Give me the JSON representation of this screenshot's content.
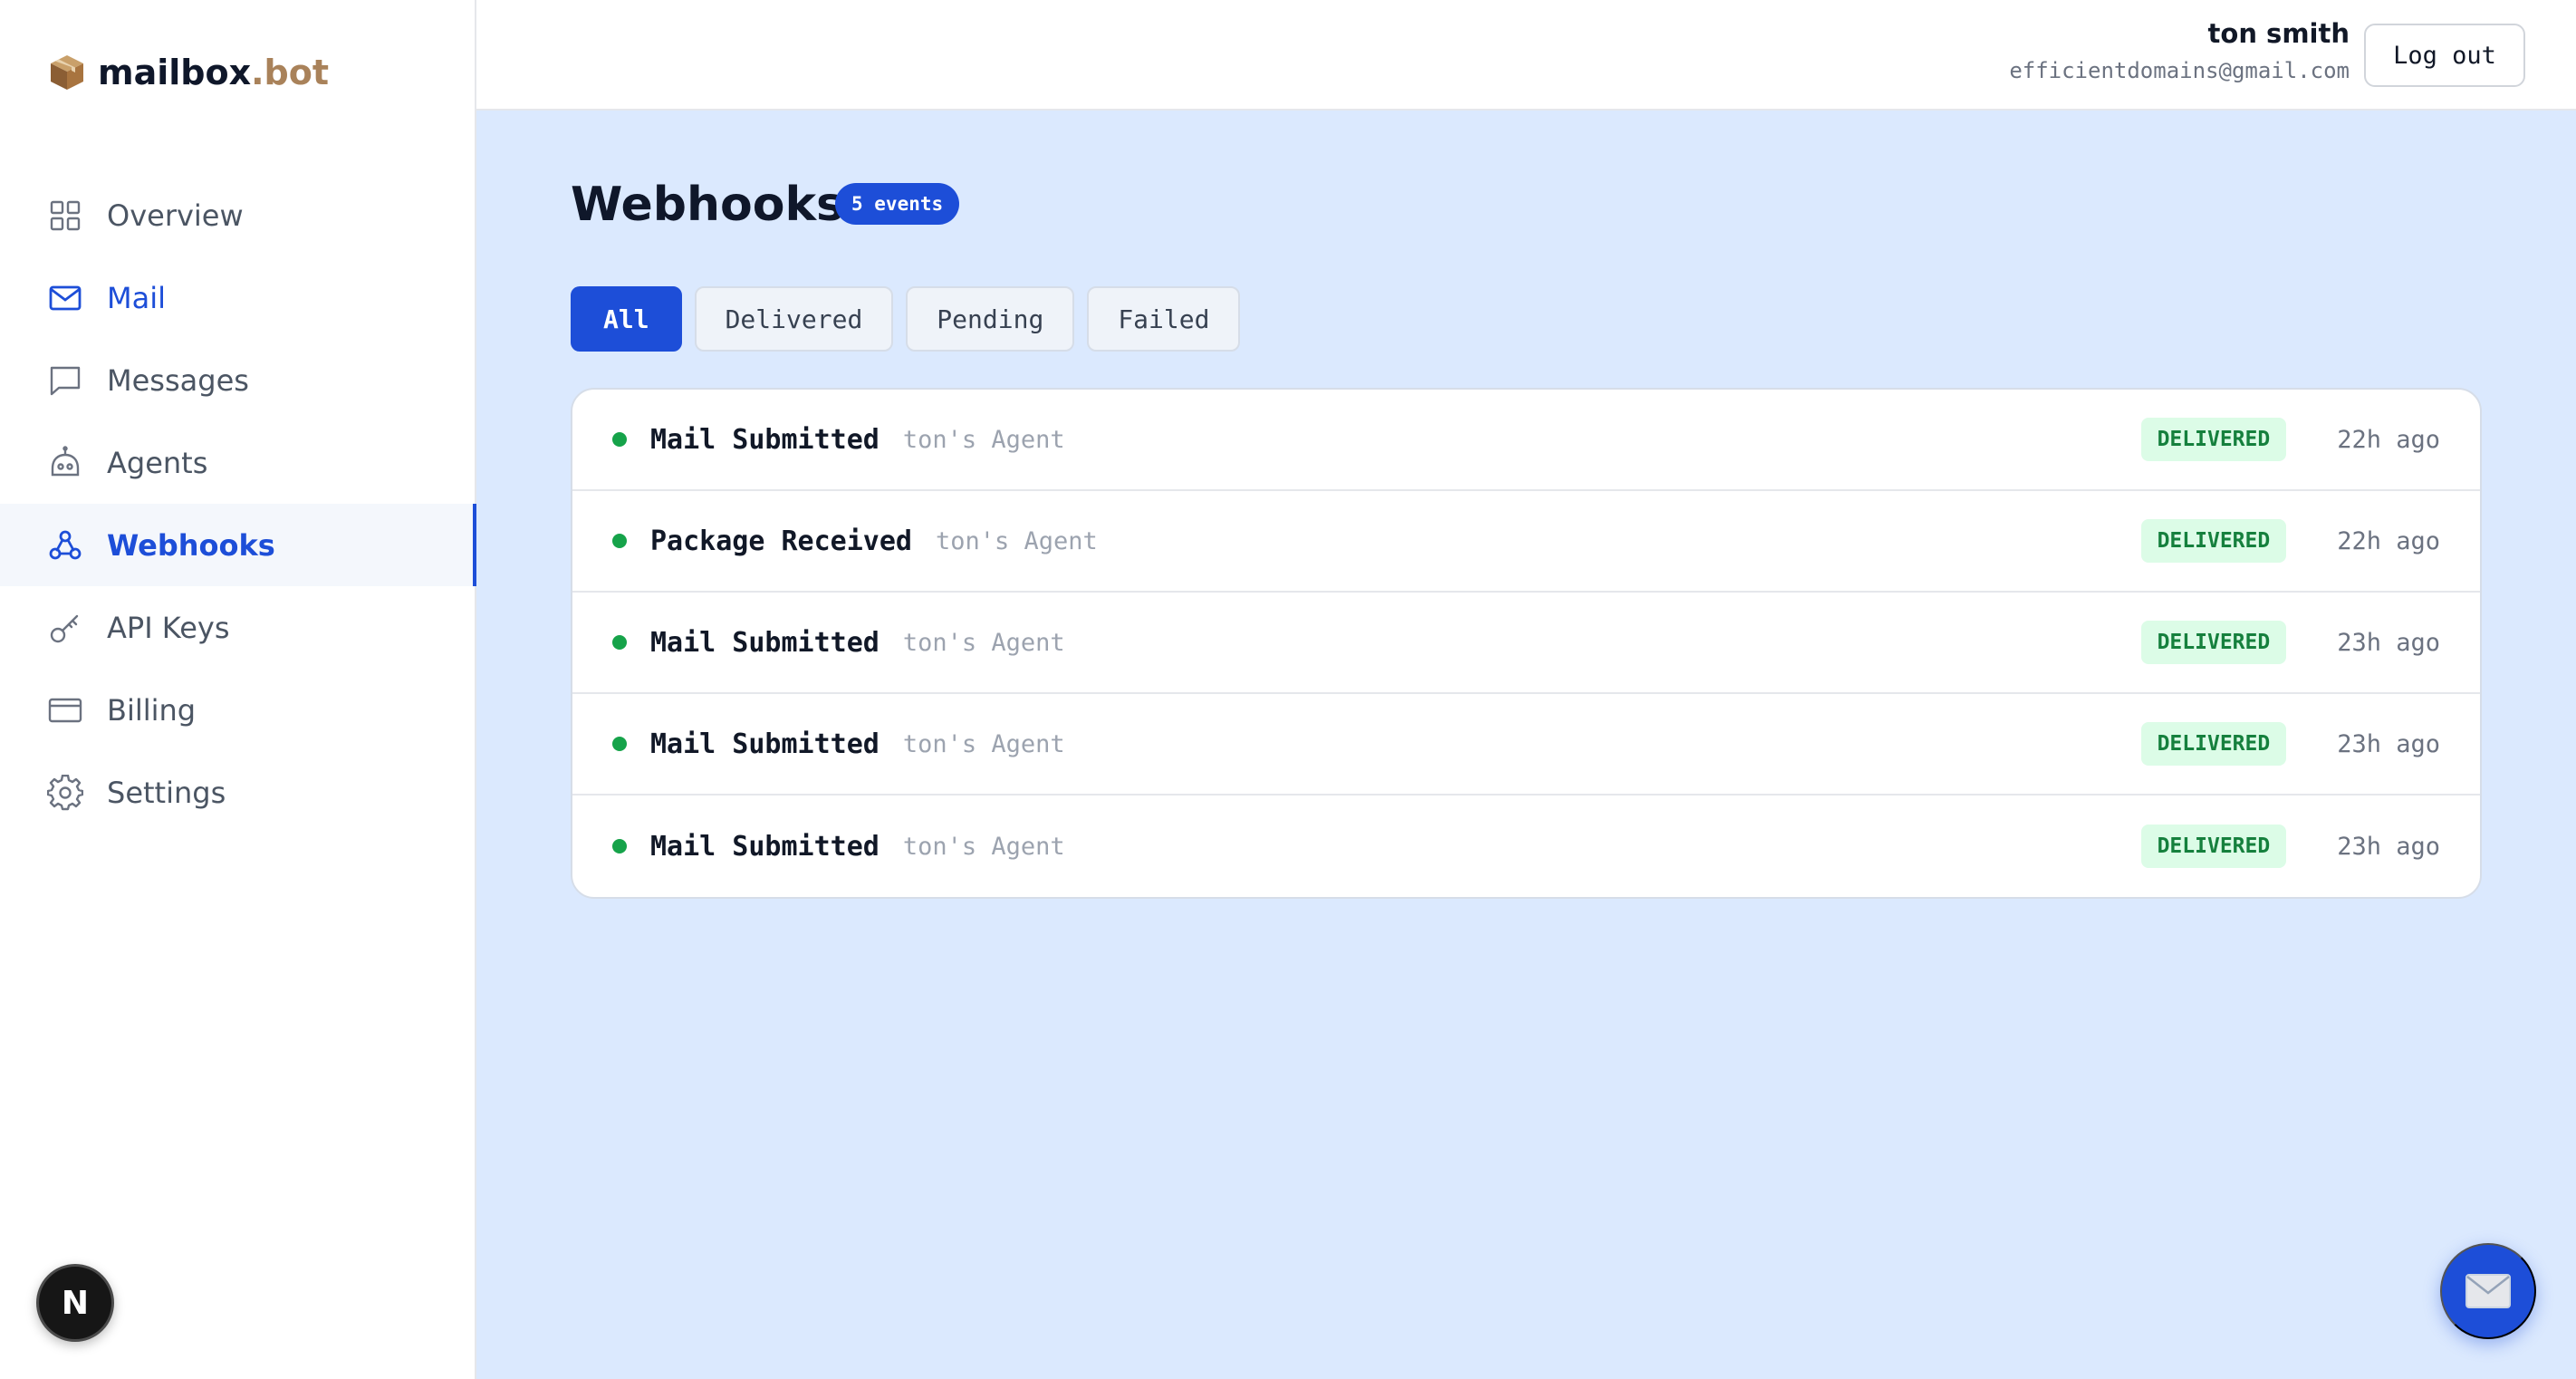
{
  "app": {
    "logo_main": "mailbox",
    "logo_accent": ".bot"
  },
  "sidebar": {
    "items": [
      {
        "label": "Overview",
        "icon": "grid-icon"
      },
      {
        "label": "Mail",
        "icon": "envelope-icon"
      },
      {
        "label": "Messages",
        "icon": "chat-bubble-icon"
      },
      {
        "label": "Agents",
        "icon": "robot-icon"
      },
      {
        "label": "Webhooks",
        "icon": "webhook-icon",
        "active": true
      },
      {
        "label": "API Keys",
        "icon": "key-icon"
      },
      {
        "label": "Billing",
        "icon": "credit-card-icon"
      },
      {
        "label": "Settings",
        "icon": "gear-icon"
      }
    ],
    "n_badge": "N"
  },
  "header": {
    "user_name": "ton smith",
    "user_email": "efficientdomains@gmail.com",
    "logout_label": "Log out"
  },
  "page": {
    "title": "Webhooks",
    "count_badge": "5 events",
    "tabs": [
      {
        "label": "All",
        "active": true
      },
      {
        "label": "Delivered"
      },
      {
        "label": "Pending"
      },
      {
        "label": "Failed"
      }
    ]
  },
  "events": [
    {
      "name": "Mail Submitted",
      "agent": "ton's Agent",
      "status": "DELIVERED",
      "time": "22h ago"
    },
    {
      "name": "Package Received",
      "agent": "ton's Agent",
      "status": "DELIVERED",
      "time": "22h ago"
    },
    {
      "name": "Mail Submitted",
      "agent": "ton's Agent",
      "status": "DELIVERED",
      "time": "23h ago"
    },
    {
      "name": "Mail Submitted",
      "agent": "ton's Agent",
      "status": "DELIVERED",
      "time": "23h ago"
    },
    {
      "name": "Mail Submitted",
      "agent": "ton's Agent",
      "status": "DELIVERED",
      "time": "23h ago"
    }
  ],
  "colors": {
    "accent": "#1d4ed8",
    "main_bg": "#dbe9fe",
    "delivered_bg": "#dcfce7",
    "delivered_text": "#15803d",
    "logo_accent": "#a9825a"
  }
}
